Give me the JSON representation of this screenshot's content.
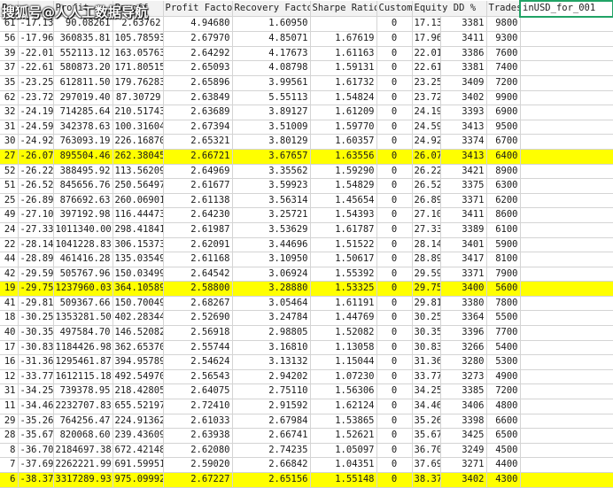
{
  "watermark": "搜狐号@人人工数据导航",
  "columns": [
    "Pa",
    "Profit",
    "Payoff",
    "Profit Factor",
    "Recovery Factor",
    "Sharpe Ratio",
    "Custom",
    "Equity DD %",
    "Trades",
    "inUSD_for_001"
  ],
  "selected_column": "inUSD_for_001",
  "highlight_color": "#ffff00",
  "rows": [
    {
      "pa": "61",
      "profit": "-17.13",
      "payoff": "90.08261",
      "profit_factor": "2.63762",
      "recovery": "4.94680",
      "sharpe": "1.60950",
      "custom": "0",
      "equity_dd": "17.13",
      "trades": "3381",
      "inusd": "9800",
      "highlight": false
    },
    {
      "pa": "56",
      "profit": "-17.96",
      "payoff": "360835.81",
      "profit_factor": "105.78593",
      "recovery": "2.67970",
      "sharpe": "4.85071",
      "custom": "1.67619",
      "equity_dd": "0",
      "trades": "17.96",
      "inusd": "3411",
      "extra": "9300",
      "highlight": false
    },
    {
      "pa": "39",
      "profit": "-22.01",
      "payoff": "552113.12",
      "profit_factor": "163.05763",
      "recovery": "2.64292",
      "sharpe": "4.17673",
      "custom": "1.61163",
      "equity_dd": "0",
      "trades": "22.01",
      "inusd": "3386",
      "extra": "7600",
      "highlight": false
    },
    {
      "pa": "37",
      "profit": "-22.61",
      "payoff": "580873.20",
      "profit_factor": "171.80515",
      "recovery": "2.65093",
      "sharpe": "4.08798",
      "custom": "1.59131",
      "equity_dd": "0",
      "trades": "22.61",
      "inusd": "3381",
      "extra": "7400",
      "highlight": false
    },
    {
      "pa": "35",
      "profit": "-23.25",
      "payoff": "612811.50",
      "profit_factor": "179.76283",
      "recovery": "2.65896",
      "sharpe": "3.99561",
      "custom": "1.61732",
      "equity_dd": "0",
      "trades": "23.25",
      "inusd": "3409",
      "extra": "7200",
      "highlight": false
    },
    {
      "pa": "62",
      "profit": "-23.72",
      "payoff": "297019.40",
      "profit_factor": "87.30729",
      "recovery": "2.63849",
      "sharpe": "5.55113",
      "custom": "1.54824",
      "equity_dd": "0",
      "trades": "23.72",
      "inusd": "3402",
      "extra": "9900",
      "highlight": false
    },
    {
      "pa": "32",
      "profit": "-24.19",
      "payoff": "714285.64",
      "profit_factor": "210.51743",
      "recovery": "2.63689",
      "sharpe": "3.89127",
      "custom": "1.61209",
      "equity_dd": "0",
      "trades": "24.19",
      "inusd": "3393",
      "extra": "6900",
      "highlight": false
    },
    {
      "pa": "31",
      "profit": "-24.59",
      "payoff": "342378.63",
      "profit_factor": "100.31604",
      "recovery": "2.67394",
      "sharpe": "3.51009",
      "custom": "1.59770",
      "equity_dd": "0",
      "trades": "24.59",
      "inusd": "3413",
      "extra": "9500",
      "highlight": false
    },
    {
      "pa": "30",
      "profit": "-24.92",
      "payoff": "763093.19",
      "profit_factor": "226.16870",
      "recovery": "2.65321",
      "sharpe": "3.80129",
      "custom": "1.60357",
      "equity_dd": "0",
      "trades": "24.92",
      "inusd": "3374",
      "extra": "6700",
      "highlight": false
    },
    {
      "pa": "27",
      "profit": "-26.07",
      "payoff": "895504.46",
      "profit_factor": "262.38045",
      "recovery": "2.66721",
      "sharpe": "3.67657",
      "custom": "1.63556",
      "equity_dd": "0",
      "trades": "26.07",
      "inusd": "3413",
      "extra": "6400",
      "highlight": true
    },
    {
      "pa": "52",
      "profit": "-26.22",
      "payoff": "388495.92",
      "profit_factor": "113.56209",
      "recovery": "2.64969",
      "sharpe": "3.35562",
      "custom": "1.59290",
      "equity_dd": "0",
      "trades": "26.22",
      "inusd": "3421",
      "extra": "8900",
      "highlight": false
    },
    {
      "pa": "51",
      "profit": "-26.52",
      "payoff": "845656.76",
      "profit_factor": "250.56497",
      "recovery": "2.61677",
      "sharpe": "3.59923",
      "custom": "1.54829",
      "equity_dd": "0",
      "trades": "26.52",
      "inusd": "3375",
      "extra": "6300",
      "highlight": false
    },
    {
      "pa": "25",
      "profit": "-26.89",
      "payoff": "876692.63",
      "profit_factor": "260.06901",
      "recovery": "2.61138",
      "sharpe": "3.56314",
      "custom": "1.45654",
      "equity_dd": "0",
      "trades": "26.89",
      "inusd": "3371",
      "extra": "6200",
      "highlight": false
    },
    {
      "pa": "49",
      "profit": "-27.10",
      "payoff": "397192.98",
      "profit_factor": "116.44473",
      "recovery": "2.64230",
      "sharpe": "3.25721",
      "custom": "1.54393",
      "equity_dd": "0",
      "trades": "27.10",
      "inusd": "3411",
      "extra": "8600",
      "highlight": false
    },
    {
      "pa": "24",
      "profit": "-27.33",
      "payoff": "1011340.00",
      "profit_factor": "298.41841",
      "recovery": "2.61987",
      "sharpe": "3.53629",
      "custom": "1.61787",
      "equity_dd": "0",
      "trades": "27.33",
      "inusd": "3389",
      "extra": "6100",
      "highlight": false
    },
    {
      "pa": "22",
      "profit": "-28.14",
      "payoff": "1041228.83",
      "profit_factor": "306.15373",
      "recovery": "2.62091",
      "sharpe": "3.44696",
      "custom": "1.51522",
      "equity_dd": "0",
      "trades": "28.14",
      "inusd": "3401",
      "extra": "5900",
      "highlight": false
    },
    {
      "pa": "44",
      "profit": "-28.89",
      "payoff": "461416.28",
      "profit_factor": "135.03549",
      "recovery": "2.61168",
      "sharpe": "3.10950",
      "custom": "1.50617",
      "equity_dd": "0",
      "trades": "28.89",
      "inusd": "3417",
      "extra": "8100",
      "highlight": false
    },
    {
      "pa": "42",
      "profit": "-29.59",
      "payoff": "505767.96",
      "profit_factor": "150.03499",
      "recovery": "2.64542",
      "sharpe": "3.06924",
      "custom": "1.55392",
      "equity_dd": "0",
      "trades": "29.59",
      "inusd": "3371",
      "extra": "7900",
      "highlight": false
    },
    {
      "pa": "19",
      "profit": "-29.75",
      "payoff": "1237960.03",
      "profit_factor": "364.10589",
      "recovery": "2.58800",
      "sharpe": "3.28880",
      "custom": "1.53325",
      "equity_dd": "0",
      "trades": "29.75",
      "inusd": "3400",
      "extra": "5600",
      "highlight": true
    },
    {
      "pa": "41",
      "profit": "-29.81",
      "payoff": "509367.66",
      "profit_factor": "150.70049",
      "recovery": "2.68267",
      "sharpe": "3.05464",
      "custom": "1.61191",
      "equity_dd": "0",
      "trades": "29.81",
      "inusd": "3380",
      "extra": "7800",
      "highlight": false
    },
    {
      "pa": "18",
      "profit": "-30.25",
      "payoff": "1353281.50",
      "profit_factor": "402.28344",
      "recovery": "2.52690",
      "sharpe": "3.24784",
      "custom": "1.44769",
      "equity_dd": "0",
      "trades": "30.25",
      "inusd": "3364",
      "extra": "5500",
      "highlight": false
    },
    {
      "pa": "40",
      "profit": "-30.35",
      "payoff": "497584.70",
      "profit_factor": "146.52082",
      "recovery": "2.56918",
      "sharpe": "2.98805",
      "custom": "1.52082",
      "equity_dd": "0",
      "trades": "30.35",
      "inusd": "3396",
      "extra": "7700",
      "highlight": false
    },
    {
      "pa": "17",
      "profit": "-30.83",
      "payoff": "1184426.98",
      "profit_factor": "362.65370",
      "recovery": "2.55744",
      "sharpe": "3.16810",
      "custom": "1.13058",
      "equity_dd": "0",
      "trades": "30.83",
      "inusd": "3266",
      "extra": "5400",
      "highlight": false
    },
    {
      "pa": "16",
      "profit": "-31.36",
      "payoff": "1295461.87",
      "profit_factor": "394.95789",
      "recovery": "2.54624",
      "sharpe": "3.13132",
      "custom": "1.15044",
      "equity_dd": "0",
      "trades": "31.36",
      "inusd": "3280",
      "extra": "5300",
      "highlight": false
    },
    {
      "pa": "12",
      "profit": "-33.77",
      "payoff": "1612115.18",
      "profit_factor": "492.54970",
      "recovery": "2.56543",
      "sharpe": "2.94202",
      "custom": "1.07230",
      "equity_dd": "0",
      "trades": "33.77",
      "inusd": "3273",
      "extra": "4900",
      "highlight": false
    },
    {
      "pa": "31",
      "profit": "-34.25",
      "payoff": "739378.95",
      "profit_factor": "218.42805",
      "recovery": "2.64075",
      "sharpe": "2.75110",
      "custom": "1.56306",
      "equity_dd": "0",
      "trades": "34.25",
      "inusd": "3385",
      "extra": "7200",
      "highlight": false
    },
    {
      "pa": "11",
      "profit": "-34.46",
      "payoff": "2232707.83",
      "profit_factor": "655.52197",
      "recovery": "2.72410",
      "sharpe": "2.91592",
      "custom": "1.62124",
      "equity_dd": "0",
      "trades": "34.46",
      "inusd": "3406",
      "extra": "4800",
      "highlight": false
    },
    {
      "pa": "29",
      "profit": "-35.26",
      "payoff": "764256.47",
      "profit_factor": "224.91362",
      "recovery": "2.61033",
      "sharpe": "2.67984",
      "custom": "1.53865",
      "equity_dd": "0",
      "trades": "35.26",
      "inusd": "3398",
      "extra": "6600",
      "highlight": false
    },
    {
      "pa": "28",
      "profit": "-35.67",
      "payoff": "820068.60",
      "profit_factor": "239.43609",
      "recovery": "2.63938",
      "sharpe": "2.66741",
      "custom": "1.52621",
      "equity_dd": "0",
      "trades": "35.67",
      "inusd": "3425",
      "extra": "6500",
      "highlight": false
    },
    {
      "pa": "8",
      "profit": "-36.70",
      "payoff": "2184697.38",
      "profit_factor": "672.42148",
      "recovery": "2.62080",
      "sharpe": "2.74235",
      "custom": "1.05097",
      "equity_dd": "0",
      "trades": "36.70",
      "inusd": "3249",
      "extra": "4500",
      "highlight": false
    },
    {
      "pa": "7",
      "profit": "-37.69",
      "payoff": "2262221.99",
      "profit_factor": "691.59951",
      "recovery": "2.59020",
      "sharpe": "2.66842",
      "custom": "1.04351",
      "equity_dd": "0",
      "trades": "37.69",
      "inusd": "3271",
      "extra": "4400",
      "highlight": false
    },
    {
      "pa": "6",
      "profit": "-38.37",
      "payoff": "3317289.93",
      "profit_factor": "975.09992",
      "recovery": "2.67227",
      "sharpe": "2.65156",
      "custom": "1.55148",
      "equity_dd": "0",
      "trades": "38.37",
      "inusd": "3402",
      "extra": "4300",
      "highlight": true
    }
  ]
}
